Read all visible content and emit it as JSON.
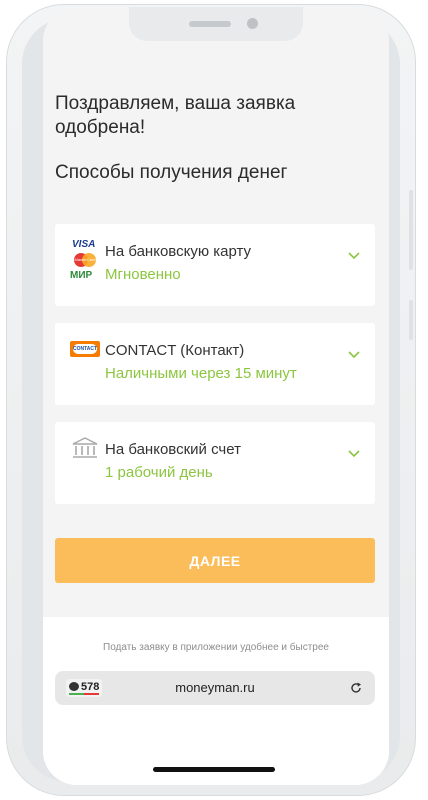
{
  "heading": "Поздравляем, ваша заявка одобрена!",
  "subheading": "Способы получения денег",
  "methods": [
    {
      "title": "На банковскую карту",
      "subtitle": "Мгновенно",
      "icon": "card-brands-icon",
      "logo_text": [
        "VISA",
        "MasterCard",
        "МИР"
      ]
    },
    {
      "title": "CONTACT (Контакт)",
      "subtitle": "Наличными через 15 минут",
      "icon": "contact-logo-icon",
      "logo_text": [
        "CONTACT"
      ]
    },
    {
      "title": "На банковский счет",
      "subtitle": "1 рабочий день",
      "icon": "bank-icon"
    }
  ],
  "next_button": "ДАЛЕЕ",
  "app_hint": "Подать заявку в приложении удобнее и быстрее",
  "browser": {
    "comment_count": "578",
    "url": "moneyman.ru"
  },
  "colors": {
    "accent_green": "#8cc63f",
    "button_orange": "#fbbd5a",
    "background": "#f4f4f4"
  }
}
